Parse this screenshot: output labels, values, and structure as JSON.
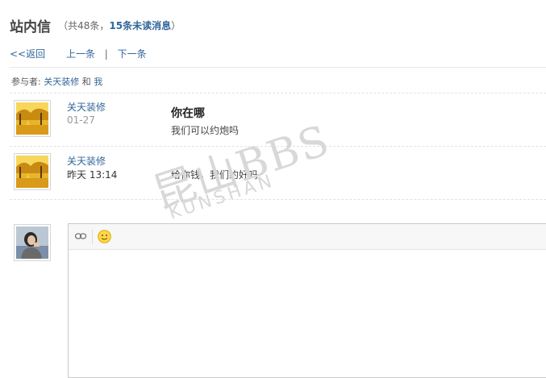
{
  "header": {
    "title": "站内信",
    "count_prefix": "（共48条，",
    "unread": "15条未读消息",
    "count_suffix": "）"
  },
  "nav": {
    "back": "<<返回",
    "prev": "上一条",
    "separator": "|",
    "next": "下一条"
  },
  "participants": {
    "label": "参与者:",
    "first": "关天装修",
    "conj": "和",
    "second": "我"
  },
  "messages": [
    {
      "user": "关天装修",
      "time": "01-27",
      "subject": "你在哪",
      "body": "我们可以约炮吗"
    },
    {
      "user": "关天装修",
      "time": "昨天 13:14",
      "subject": "",
      "body": "给你钱，我们约好吗"
    }
  ],
  "watermark": {
    "big": "昆山BBS",
    "small": "KUNSHAN"
  },
  "icons": {
    "link": "link-icon",
    "smile": "smiley-icon"
  }
}
